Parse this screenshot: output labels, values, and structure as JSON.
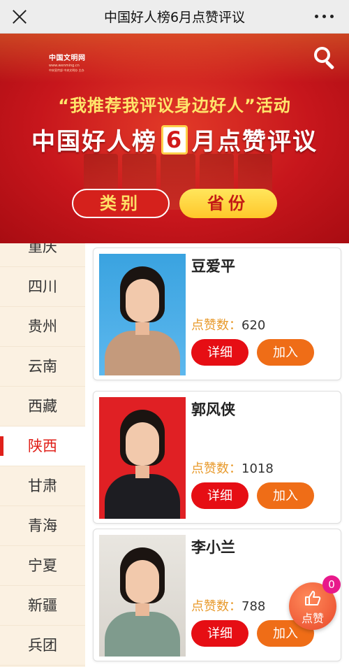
{
  "header": {
    "title": "中国好人榜6月点赞评议"
  },
  "banner": {
    "logo": {
      "name": "中国文明网",
      "url_text": "www.wenming.cn",
      "sub_text": "中央宣传部 中央文明办 主办"
    },
    "slogan": "“我推荐我评议身边好人”活动",
    "headline_pre": "中国好人榜",
    "headline_month": "6",
    "headline_post": "月点赞评议",
    "category_button": "类别",
    "province_button": "省份"
  },
  "sidebar": {
    "items": [
      {
        "label": "重庆"
      },
      {
        "label": "四川"
      },
      {
        "label": "贵州"
      },
      {
        "label": "云南"
      },
      {
        "label": "西藏"
      },
      {
        "label": "陕西",
        "active": true
      },
      {
        "label": "甘肃"
      },
      {
        "label": "青海"
      },
      {
        "label": "宁夏"
      },
      {
        "label": "新疆"
      },
      {
        "label": "兵团"
      }
    ]
  },
  "cards": [
    {
      "name": "豆爱平",
      "likes_label": "点赞数：",
      "likes": "620",
      "detail_label": "详细",
      "join_label": "加入"
    },
    {
      "name": "郭风侠",
      "likes_label": "点赞数：",
      "likes": "1018",
      "detail_label": "详细",
      "join_label": "加入"
    },
    {
      "name": "李小兰",
      "likes_label": "点赞数：",
      "likes": "788",
      "detail_label": "详细",
      "join_label": "加入"
    }
  ],
  "fab": {
    "label": "点赞",
    "badge": "0"
  },
  "colors": {
    "accent_red": "#e60e14",
    "accent_orange": "#ef6d17",
    "likes_label": "#e89a2c",
    "sidebar_bg": "#fbf1e2"
  },
  "icons": {
    "close": "close-icon",
    "more": "more-icon",
    "search": "search-icon",
    "like": "like-hand-icon"
  }
}
